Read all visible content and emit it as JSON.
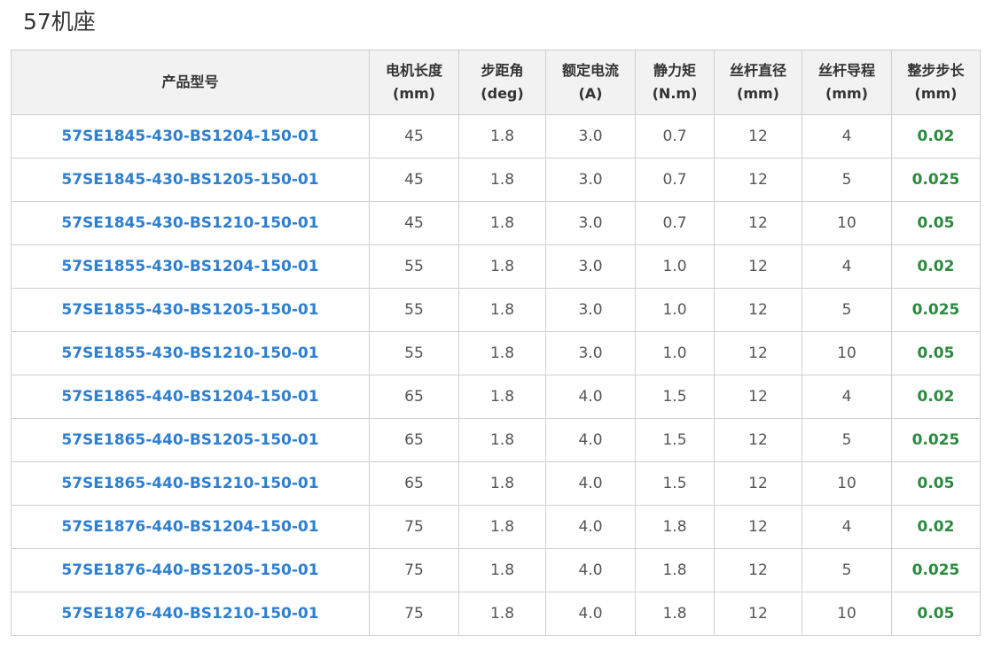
{
  "title": "57机座",
  "table": {
    "headers": [
      {
        "line1": "产品型号",
        "line2": ""
      },
      {
        "line1": "电机长度",
        "line2": "(mm)"
      },
      {
        "line1": "步距角",
        "line2": "(deg)"
      },
      {
        "line1": "额定电流",
        "line2": "(A)"
      },
      {
        "line1": "静力矩",
        "line2": "(N.m)"
      },
      {
        "line1": "丝杆直径",
        "line2": "(mm)"
      },
      {
        "line1": "丝杆导程",
        "line2": "(mm)"
      },
      {
        "line1": "整步步长",
        "line2": "(mm)"
      }
    ],
    "rows": [
      [
        "57SE1845-430-BS1204-150-01",
        "45",
        "1.8",
        "3.0",
        "0.7",
        "12",
        "4",
        "0.02"
      ],
      [
        "57SE1845-430-BS1205-150-01",
        "45",
        "1.8",
        "3.0",
        "0.7",
        "12",
        "5",
        "0.025"
      ],
      [
        "57SE1845-430-BS1210-150-01",
        "45",
        "1.8",
        "3.0",
        "0.7",
        "12",
        "10",
        "0.05"
      ],
      [
        "57SE1855-430-BS1204-150-01",
        "55",
        "1.8",
        "3.0",
        "1.0",
        "12",
        "4",
        "0.02"
      ],
      [
        "57SE1855-430-BS1205-150-01",
        "55",
        "1.8",
        "3.0",
        "1.0",
        "12",
        "5",
        "0.025"
      ],
      [
        "57SE1855-430-BS1210-150-01",
        "55",
        "1.8",
        "3.0",
        "1.0",
        "12",
        "10",
        "0.05"
      ],
      [
        "57SE1865-440-BS1204-150-01",
        "65",
        "1.8",
        "4.0",
        "1.5",
        "12",
        "4",
        "0.02"
      ],
      [
        "57SE1865-440-BS1205-150-01",
        "65",
        "1.8",
        "4.0",
        "1.5",
        "12",
        "5",
        "0.025"
      ],
      [
        "57SE1865-440-BS1210-150-01",
        "65",
        "1.8",
        "4.0",
        "1.5",
        "12",
        "10",
        "0.05"
      ],
      [
        "57SE1876-440-BS1204-150-01",
        "75",
        "1.8",
        "4.0",
        "1.8",
        "12",
        "4",
        "0.02"
      ],
      [
        "57SE1876-440-BS1205-150-01",
        "75",
        "1.8",
        "4.0",
        "1.8",
        "12",
        "5",
        "0.025"
      ],
      [
        "57SE1876-440-BS1210-150-01",
        "75",
        "1.8",
        "4.0",
        "1.8",
        "12",
        "10",
        "0.05"
      ]
    ]
  },
  "colors": {
    "link": "#2e7fd0",
    "step": "#2b8a3e",
    "header_bg": "#f2f2f2",
    "border": "#cfcfcf"
  }
}
